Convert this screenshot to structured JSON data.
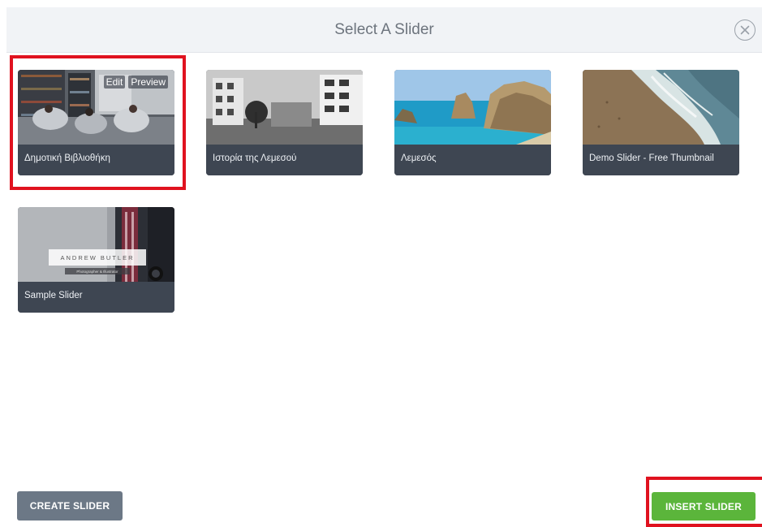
{
  "dialog": {
    "title": "Select A Slider",
    "close_icon": "close-circle-icon"
  },
  "sliders": [
    {
      "label": "Δημοτική Βιβλιοθήκη",
      "edit_label": "Edit",
      "preview_label": "Preview",
      "selected": true
    },
    {
      "label": "Ιστορία της Λεμεσού"
    },
    {
      "label": "Λεμεσός"
    },
    {
      "label": "Demo Slider - Free Thumbnail"
    },
    {
      "label": "Sample Slider",
      "thumbnail_text": "ANDREW BUTLER",
      "thumbnail_subtext": "Photographer & Illustrator"
    }
  ],
  "footer": {
    "create_label": "CREATE SLIDER",
    "insert_label": "INSERT SLIDER"
  },
  "colors": {
    "highlight": "#e0121f",
    "insert_button": "#5bb53b",
    "create_button": "#6c7886",
    "card_label_bar": "#3e4652"
  }
}
